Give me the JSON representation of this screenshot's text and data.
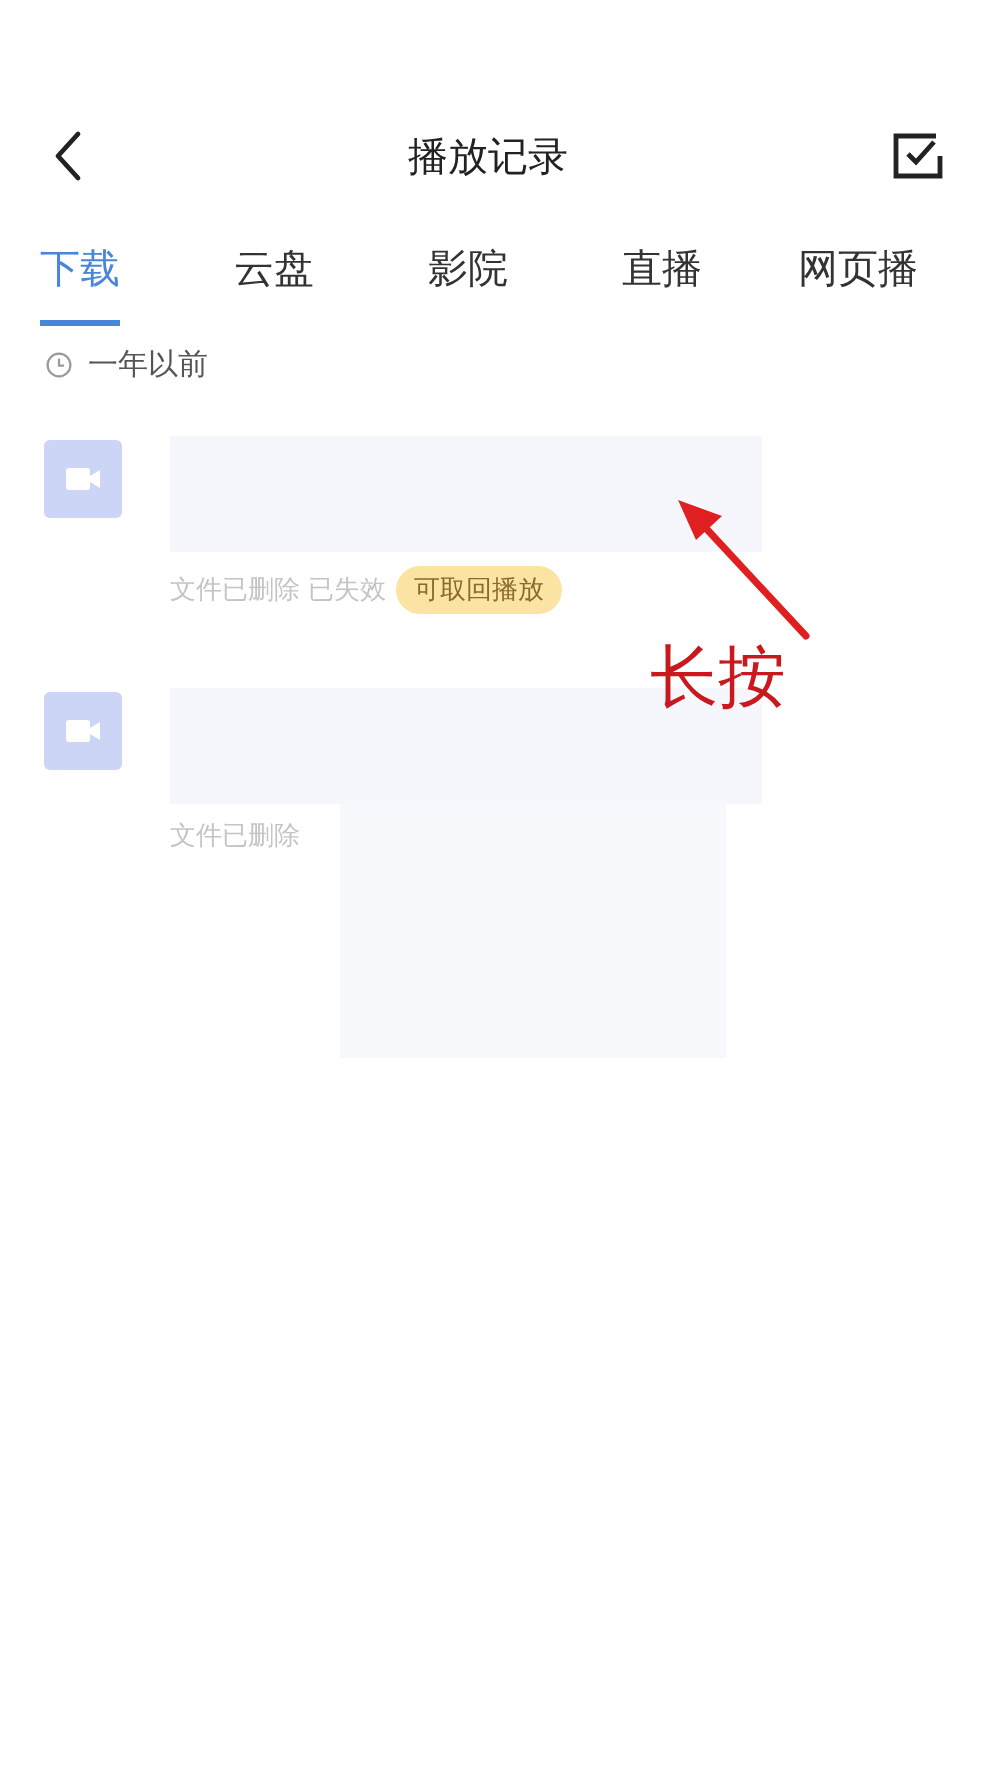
{
  "header": {
    "title": "播放记录"
  },
  "tabs": [
    {
      "label": "下载",
      "selected": true
    },
    {
      "label": "云盘",
      "selected": false
    },
    {
      "label": "影院",
      "selected": false
    },
    {
      "label": "直播",
      "selected": false
    },
    {
      "label": "网页播",
      "selected": false
    }
  ],
  "section": {
    "label": "一年以前"
  },
  "items": [
    {
      "status": "文件已删除 已失效",
      "badge": "可取回播放"
    },
    {
      "status": "文件已删除"
    }
  ],
  "annotation": {
    "label": "长按"
  }
}
